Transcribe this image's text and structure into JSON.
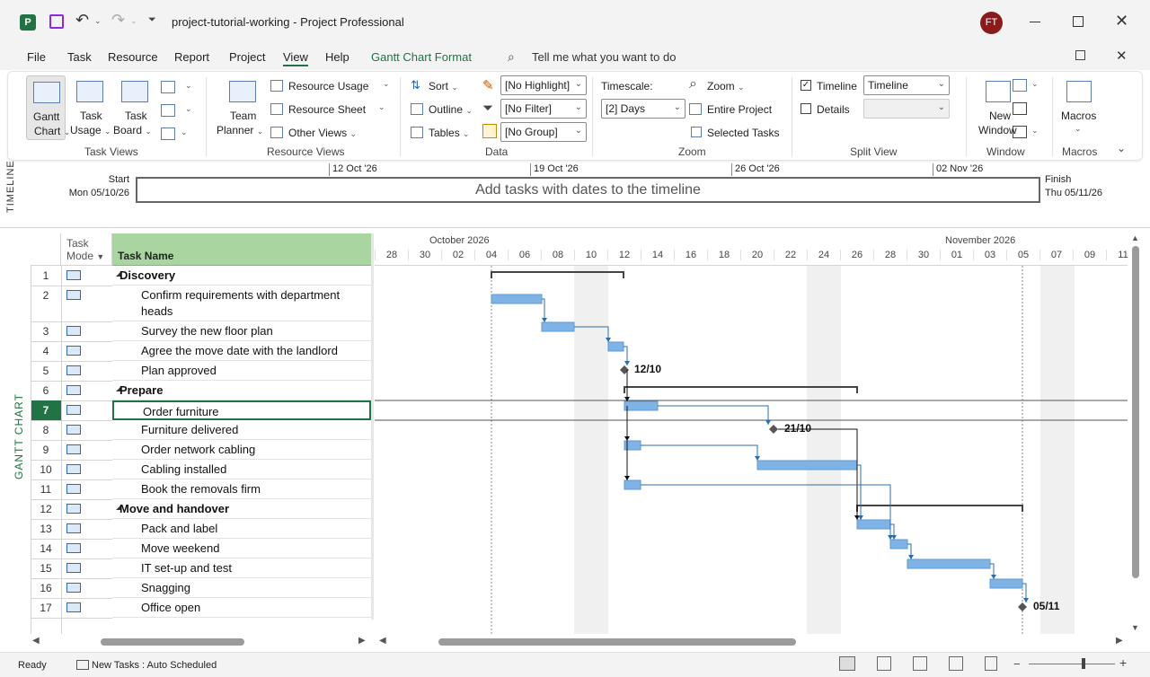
{
  "titlebar": {
    "file_title": "project-tutorial-working",
    "separator": "-",
    "app_name": "Project Professional",
    "user_initials": "FT"
  },
  "menu": {
    "items": [
      "File",
      "Task",
      "Resource",
      "Report",
      "Project",
      "View",
      "Help"
    ],
    "contextual": "Gantt Chart Format",
    "search_placeholder": "Tell me what you want to do",
    "active": "View"
  },
  "ribbon": {
    "task_views": {
      "gantt_label1": "Gantt",
      "gantt_label2": "Chart",
      "task_usage1": "Task",
      "task_usage2": "Usage",
      "task_board1": "Task",
      "task_board2": "Board",
      "title": "Task Views"
    },
    "resource_views": {
      "team_planner1": "Team",
      "team_planner2": "Planner",
      "resource_usage": "Resource Usage",
      "resource_sheet": "Resource Sheet",
      "other_views": "Other Views",
      "title": "Resource Views"
    },
    "data": {
      "sort": "Sort",
      "outline": "Outline",
      "tables": "Tables",
      "highlight": "[No Highlight]",
      "filter": "[No Filter]",
      "group": "[No Group]",
      "title": "Data"
    },
    "zoom": {
      "timescale_label": "Timescale:",
      "timescale_value": "[2] Days",
      "zoom": "Zoom",
      "entire_project": "Entire Project",
      "selected_tasks": "Selected Tasks",
      "title": "Zoom"
    },
    "split_view": {
      "timeline_label": "Timeline",
      "timeline_checked": true,
      "timeline_value": "Timeline",
      "details_label": "Details",
      "details_checked": false,
      "title": "Split View"
    },
    "window": {
      "new_window1": "New",
      "new_window2": "Window",
      "title": "Window"
    },
    "macros": {
      "macros": "Macros",
      "title": "Macros"
    }
  },
  "timeline": {
    "side_label": "TIMELINE",
    "start_label": "Start",
    "start_date": "Mon 05/10/26",
    "finish_label": "Finish",
    "finish_date": "Thu 05/11/26",
    "placeholder": "Add tasks with dates to the timeline",
    "ticks": [
      "12 Oct '26",
      "19 Oct '26",
      "26 Oct '26",
      "02 Nov '26"
    ]
  },
  "gantt": {
    "side_label": "GANTT CHART",
    "col_task_mode1": "Task",
    "col_task_mode2": "Mode",
    "col_task_name": "Task Name",
    "month_labels": [
      "October 2026",
      "November 2026"
    ],
    "day_labels": [
      "28",
      "30",
      "02",
      "04",
      "06",
      "08",
      "10",
      "12",
      "14",
      "16",
      "18",
      "20",
      "22",
      "24",
      "26",
      "28",
      "30",
      "01",
      "03",
      "05",
      "07",
      "09",
      "11"
    ],
    "rows": [
      {
        "id": "1",
        "name": "Discovery",
        "summary": true
      },
      {
        "id": "2",
        "name": "Confirm requirements with department",
        "name2": "heads"
      },
      {
        "id": "3",
        "name": "Survey the new floor plan"
      },
      {
        "id": "4",
        "name": "Agree the move date with the landlord"
      },
      {
        "id": "5",
        "name": "Plan approved"
      },
      {
        "id": "6",
        "name": "Prepare",
        "summary": true
      },
      {
        "id": "7",
        "name": "Order furniture",
        "selected": true
      },
      {
        "id": "8",
        "name": "Furniture delivered"
      },
      {
        "id": "9",
        "name": "Order network cabling"
      },
      {
        "id": "10",
        "name": "Cabling installed"
      },
      {
        "id": "11",
        "name": "Book the removals firm"
      },
      {
        "id": "12",
        "name": "Move and handover",
        "summary": true
      },
      {
        "id": "13",
        "name": "Pack and label"
      },
      {
        "id": "14",
        "name": "Move weekend"
      },
      {
        "id": "15",
        "name": "IT set-up and test"
      },
      {
        "id": "16",
        "name": "Snagging"
      },
      {
        "id": "17",
        "name": "Office open"
      }
    ],
    "milestone_labels": {
      "m5": "12/10",
      "m8": "21/10",
      "m17": "05/11"
    }
  },
  "status": {
    "ready": "Ready",
    "new_tasks": "New Tasks : Auto Scheduled"
  },
  "colors": {
    "accent": "#217346",
    "bar": "#7fb2e5",
    "header_green": "#a8d5a0",
    "user_badge": "#8b1a1a"
  }
}
